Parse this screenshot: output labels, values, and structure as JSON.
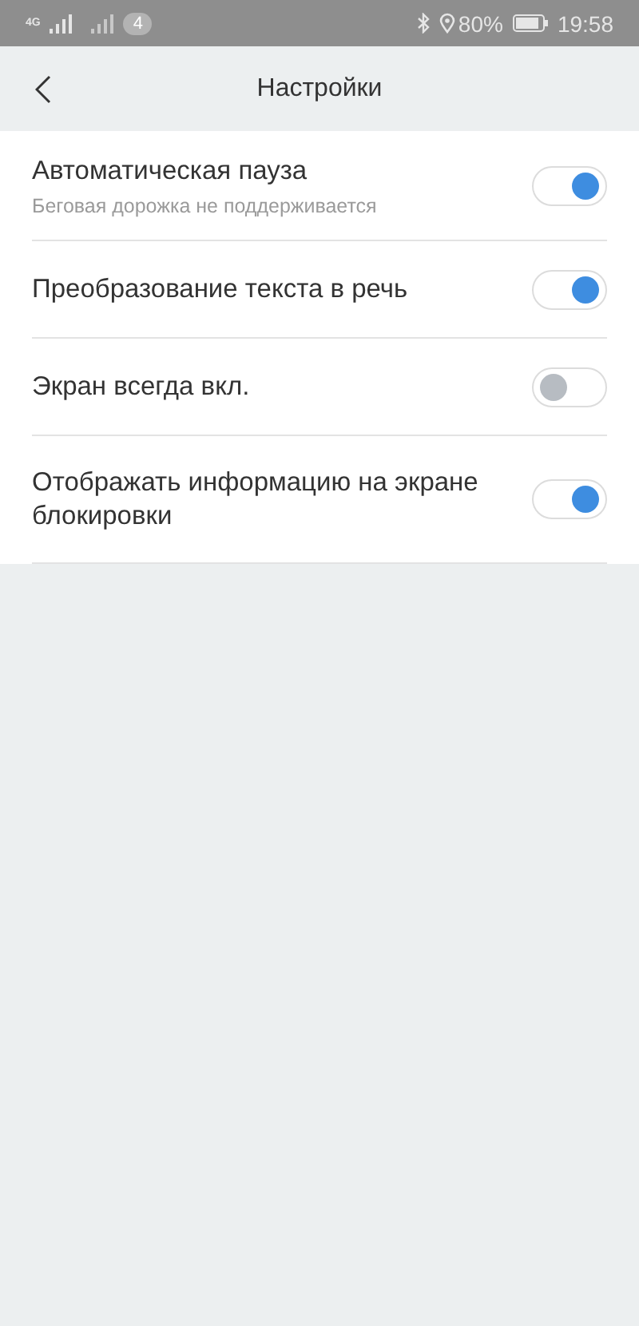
{
  "status_bar": {
    "network": "4G",
    "notification_count": "4",
    "battery_percent": "80%",
    "time": "19:58"
  },
  "header": {
    "title": "Настройки"
  },
  "settings": [
    {
      "label": "Автоматическая пауза",
      "subtitle": "Беговая дорожка не поддерживается",
      "on": true
    },
    {
      "label": "Преобразование текста в речь",
      "on": true
    },
    {
      "label": "Экран всегда вкл.",
      "on": false
    },
    {
      "label": "Отображать информацию на экране блокировки",
      "on": true
    }
  ]
}
